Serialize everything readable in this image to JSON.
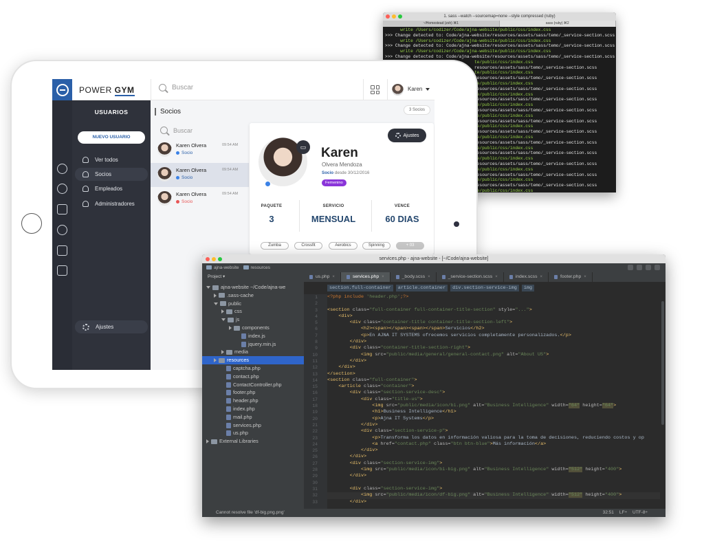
{
  "terminal": {
    "title": "1. sass --watch --sourcemap=none --style compressed  (ruby)",
    "tabs": [
      "~/Homestead (zsh)  ⌘1",
      "sass (ruby)  ⌘2"
    ],
    "lines": [
      {
        "t": "      write /Users/codizer/Code/ajna-website/public/css/index.css",
        "c": "g"
      },
      {
        "t": ">>> Change detected to: Code/ajna-website/resources/assets/sass/temo/_service-section.scss",
        "c": "w"
      },
      {
        "t": "      write /Users/codizer/Code/ajna-website/public/css/index.css",
        "c": "g"
      },
      {
        "t": ">>> Change detected to: Code/ajna-website/resources/assets/sass/temo/_service-section.scss",
        "c": "w"
      },
      {
        "t": "      write /Users/codizer/Code/ajna-website/public/css/index.css",
        "c": "g"
      },
      {
        "t": ">>> Change detected to: Code/ajna-website/resources/assets/sass/temo/_service-section.scss",
        "c": "w"
      },
      {
        "t": "                                   te/public/css/index.css",
        "c": "g"
      },
      {
        "t": "                                   resources/assets/sass/temo/_service-section.scss",
        "c": "w"
      },
      {
        "t": "                                   te/public/css/index.css",
        "c": "g"
      },
      {
        "t": "                                   resources/assets/sass/temo/_service-section.scss",
        "c": "w"
      },
      {
        "t": "                                   te/public/css/index.css",
        "c": "g"
      },
      {
        "t": "                                   resources/assets/sass/temo/_service-section.scss",
        "c": "w"
      },
      {
        "t": "                                   te/public/css/index.css",
        "c": "g"
      },
      {
        "t": "                                   resources/assets/sass/temo/_service-section.scss",
        "c": "w"
      },
      {
        "t": "                                   te/public/css/index.css",
        "c": "g"
      },
      {
        "t": "                                   resources/assets/sass/temo/_service-section.scss",
        "c": "w"
      },
      {
        "t": "                                   te/public/css/index.css",
        "c": "g"
      },
      {
        "t": "                                   resources/assets/sass/temo/_service-section.scss",
        "c": "w"
      },
      {
        "t": "                                   te/public/css/index.css",
        "c": "g"
      },
      {
        "t": "                                   resources/assets/sass/temo/_service-section.scss",
        "c": "w"
      },
      {
        "t": "                                   te/public/css/index.css",
        "c": "g"
      },
      {
        "t": "                                   resources/assets/sass/temo/_service-section.scss",
        "c": "w"
      },
      {
        "t": "                                   te/public/css/index.css",
        "c": "g"
      },
      {
        "t": "                                   resources/assets/sass/temo/_service-section.scss",
        "c": "w"
      },
      {
        "t": "                                   te/public/css/index.css",
        "c": "g"
      },
      {
        "t": "                                   resources/assets/sass/temo/_service-section.scss",
        "c": "w"
      },
      {
        "t": "                                   te/public/css/index.css",
        "c": "g"
      },
      {
        "t": "                                   resources/assets/sass/temo/_service-section.scss",
        "c": "w"
      },
      {
        "t": "                                   te/public/css/index.css",
        "c": "g"
      },
      {
        "t": "                                   resources/assets/sass/temo/_service-section.scss",
        "c": "w"
      },
      {
        "t": "                                   te/public/css/index.css",
        "c": "g"
      }
    ]
  },
  "app": {
    "brand_light": "POWER ",
    "brand_bold": "GYM",
    "search_placeholder": "Buscar",
    "user_name": "Karen",
    "sidenav": {
      "title": "USUARIOS",
      "new_user": "NUEVO USUARIO",
      "items": [
        "Ver todos",
        "Socios",
        "Empleados",
        "Administradores"
      ],
      "settings": "Ajustes"
    },
    "list": {
      "title": "Socios",
      "search_placeholder": "Buscar",
      "items": [
        {
          "name": "Karen Olvera",
          "time": "09:54 AM",
          "role": "Socio",
          "color": "#3b82e6"
        },
        {
          "name": "Karen Olvera",
          "time": "09:54 AM",
          "role": "Socio",
          "color": "#3b82e6"
        },
        {
          "name": "Karen Olvera",
          "time": "09:54 AM",
          "role": "Socio",
          "color": "#e85555"
        }
      ]
    },
    "detail": {
      "count": "3 Socios",
      "settings_btn": "Ajustes",
      "first_name": "Karen",
      "last_name": "Olvera Mendoza",
      "role": "Socio",
      "since": " desde 30/12/2016",
      "gender": "Femenino",
      "stats": [
        {
          "label": "PAQUETE",
          "value": "3"
        },
        {
          "label": "SERVICIO",
          "value": "MENSUAL"
        },
        {
          "label": "VENCE",
          "value": "60 DIAS"
        }
      ],
      "chips": [
        "Zumba",
        "Crossfit",
        "Aerobics",
        "Spinning",
        "+ 03"
      ]
    }
  },
  "ide": {
    "title": "services.php - ajna-website - [~/Code/ajna-website]",
    "nav": [
      "ajna-website",
      "resources"
    ],
    "project_label": "Project",
    "tree": [
      {
        "label": "ajna-website ~/Code/ajna-we",
        "indent": 0,
        "type": "folder",
        "arrow": "open"
      },
      {
        "label": ".sass-cache",
        "indent": 1,
        "type": "folder",
        "arrow": "closed"
      },
      {
        "label": "public",
        "indent": 1,
        "type": "folder",
        "arrow": "open"
      },
      {
        "label": "css",
        "indent": 2,
        "type": "folder",
        "arrow": "closed"
      },
      {
        "label": "js",
        "indent": 2,
        "type": "folder",
        "arrow": "open"
      },
      {
        "label": "components",
        "indent": 3,
        "type": "folder",
        "arrow": "closed"
      },
      {
        "label": "index.js",
        "indent": 4,
        "type": "file",
        "arrow": "none"
      },
      {
        "label": "jquery.min.js",
        "indent": 4,
        "type": "file",
        "arrow": "none"
      },
      {
        "label": "media",
        "indent": 2,
        "type": "folder",
        "arrow": "closed"
      },
      {
        "label": "resources",
        "indent": 1,
        "type": "folder",
        "arrow": "closed",
        "selected": true
      },
      {
        "label": "captcha.php",
        "indent": 2,
        "type": "file",
        "arrow": "none"
      },
      {
        "label": "contact.php",
        "indent": 2,
        "type": "file",
        "arrow": "none"
      },
      {
        "label": "ContactController.php",
        "indent": 2,
        "type": "file",
        "arrow": "none"
      },
      {
        "label": "footer.php",
        "indent": 2,
        "type": "file",
        "arrow": "none"
      },
      {
        "label": "header.php",
        "indent": 2,
        "type": "file",
        "arrow": "none"
      },
      {
        "label": "index.php",
        "indent": 2,
        "type": "file",
        "arrow": "none"
      },
      {
        "label": "mail.php",
        "indent": 2,
        "type": "file",
        "arrow": "none"
      },
      {
        "label": "services.php",
        "indent": 2,
        "type": "file",
        "arrow": "none"
      },
      {
        "label": "us.php",
        "indent": 2,
        "type": "file",
        "arrow": "none"
      },
      {
        "label": "External Libraries",
        "indent": 0,
        "type": "lib",
        "arrow": "closed"
      }
    ],
    "tabs": [
      {
        "label": "us.php",
        "active": false
      },
      {
        "label": "services.php",
        "active": true
      },
      {
        "label": "_body.scss",
        "active": false
      },
      {
        "label": "_service-section.scss",
        "active": false
      },
      {
        "label": "index.scss",
        "active": false
      },
      {
        "label": "footer.php",
        "active": false
      }
    ],
    "crumbs": [
      "section.full-container",
      "article.container",
      "div.section-service-img",
      "img"
    ],
    "status_text": "Cannot resolve file 'df-big.png.png'",
    "status_pos": "32:51",
    "status_lf": "LF÷",
    "status_enc": "UTF-8÷",
    "code": [
      "<?php include 'header.php';?>",
      "",
      "<section class=\"full-container full-container-title-section\" style=\"...\">",
      "    <div>",
      "        <div class=\"container-title container-title-section-left\">",
      "            <h2><span></span><span></span>Servicios</h2>",
      "            <p>En AJNA IT SYSTEMS ofrecemos servicios completamente personalizados.</p>",
      "        </div>",
      "        <div class=\"container-title-section-right\">",
      "            <img src=\"public/media/general/general-contact.png\" alt=\"About US\">",
      "        </div>",
      "    </div>",
      "</section>",
      "<section class=\"full-container\">",
      "    <article class=\"container\">",
      "        <div class=\"section-service-desc\">",
      "            <div class=\"title-us\">",
      "                <img src=\"public/media/icon/bi.png\" alt=\"Business Intelligence\" width=\"64\" height=\"64\">",
      "                <h1>Business Intelligence</h1>",
      "                <p>Ajna IT Systems</p>",
      "            </div>",
      "            <div class=\"section-service-p\">",
      "                <p>Transforma los datos en información valiosa para la toma de decisiones, reduciendo costos y op",
      "                <a href=\"contact.php\" class=\"btn btn-blue\">Más información</a>",
      "            </div>",
      "        </div>",
      "        <div class=\"section-service-img\">",
      "            <img src=\"public/media/icon/bi-big.png\" alt=\"Business Intelligence\" width=\"512\" height=\"400\">",
      "        </div>",
      "",
      "        <div class=\"section-service-img\">",
      "            <img src=\"public/media/icon/df-big.png\" alt=\"Business Intelligence\" width=\"512\" height=\"400\">",
      "        </div>"
    ]
  }
}
